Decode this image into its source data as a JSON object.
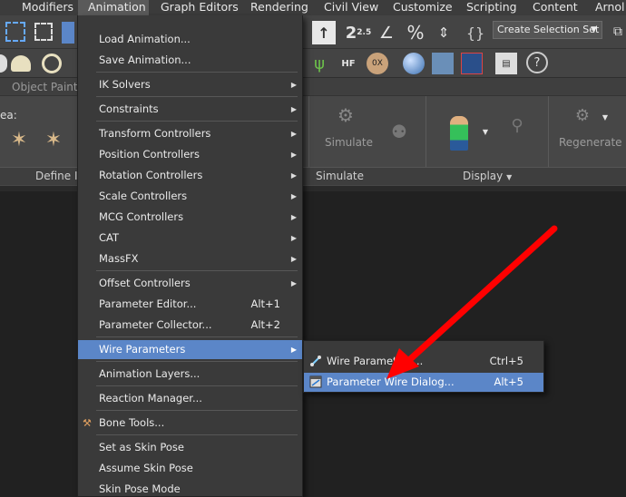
{
  "menubar": {
    "items": [
      "Modifiers",
      "Animation",
      "Graph Editors",
      "Rendering",
      "Civil View",
      "Customize",
      "Scripting",
      "Content",
      "Arnol"
    ]
  },
  "toolbar": {
    "selection_set": "Create Selection Set",
    "snap_label": "2.5"
  },
  "ribbon": {
    "tab": "Object Paint",
    "area_label": "ea:",
    "simulate_btn": "Simulate",
    "regenerate_btn": "Regenerate",
    "footer": {
      "define": "Define Id",
      "simulate": "Simulate",
      "display": "Display"
    }
  },
  "animation_menu": {
    "items": [
      {
        "label": "Load Animation...",
        "shortcut": ""
      },
      {
        "label": "Save Animation...",
        "shortcut": ""
      },
      {
        "label": "IK Solvers",
        "shortcut": ""
      },
      {
        "label": "Constraints",
        "shortcut": ""
      },
      {
        "label": "Transform Controllers",
        "shortcut": ""
      },
      {
        "label": "Position Controllers",
        "shortcut": ""
      },
      {
        "label": "Rotation Controllers",
        "shortcut": ""
      },
      {
        "label": "Scale Controllers",
        "shortcut": ""
      },
      {
        "label": "MCG Controllers",
        "shortcut": ""
      },
      {
        "label": "CAT",
        "shortcut": ""
      },
      {
        "label": "MassFX",
        "shortcut": ""
      },
      {
        "label": "Offset Controllers",
        "shortcut": ""
      },
      {
        "label": "Parameter Editor...",
        "shortcut": "Alt+1"
      },
      {
        "label": "Parameter Collector...",
        "shortcut": "Alt+2"
      },
      {
        "label": "Wire Parameters",
        "shortcut": ""
      },
      {
        "label": "Animation Layers...",
        "shortcut": ""
      },
      {
        "label": "Reaction Manager...",
        "shortcut": ""
      },
      {
        "label": "Bone Tools...",
        "shortcut": ""
      },
      {
        "label": "Set as Skin Pose",
        "shortcut": ""
      },
      {
        "label": "Assume Skin Pose",
        "shortcut": ""
      },
      {
        "label": "Skin Pose Mode",
        "shortcut": ""
      }
    ]
  },
  "wire_submenu": {
    "items": [
      {
        "label": "Wire Parameters...",
        "shortcut": "Ctrl+5"
      },
      {
        "label": "Parameter Wire Dialog...",
        "shortcut": "Alt+5"
      }
    ]
  },
  "colors": {
    "highlight": "#5b86c8",
    "annotation_arrow": "#ff0000"
  }
}
